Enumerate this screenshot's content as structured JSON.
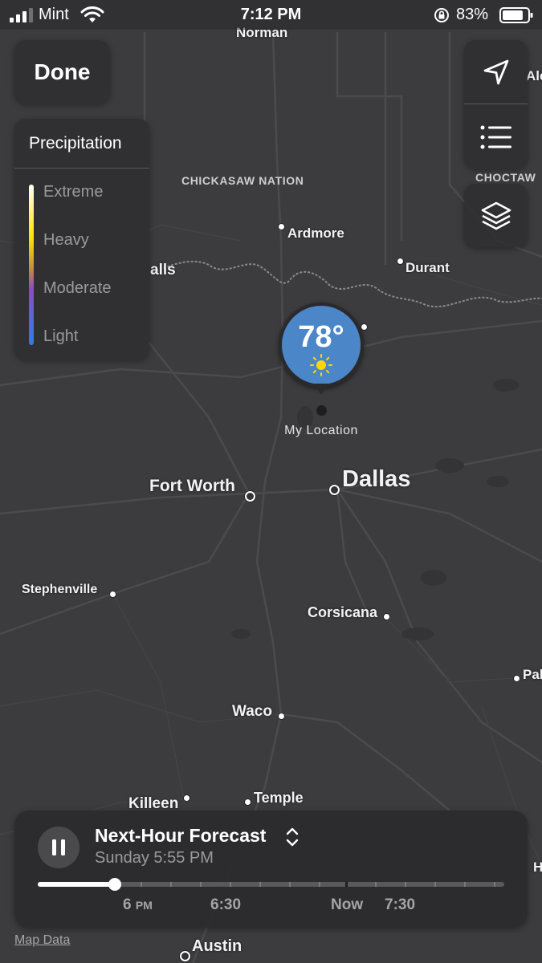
{
  "status_bar": {
    "carrier": "Mint",
    "time": "7:12 PM",
    "battery_percent": "83%",
    "battery_level": 0.83
  },
  "done_label": "Done",
  "controls": {
    "location_icon": "location-arrow-icon",
    "list_icon": "list-icon",
    "layers_icon": "layers-icon"
  },
  "legend": {
    "title": "Precipitation",
    "levels": [
      "Extreme",
      "Heavy",
      "Moderate",
      "Light"
    ]
  },
  "marker": {
    "temperature": "78°",
    "condition_icon": "sun-icon",
    "location_label": "My Location"
  },
  "map": {
    "cities": {
      "norman": "Norman",
      "ardmore": "Ardmore",
      "durant": "Durant",
      "alls": "alls",
      "ale": "Ale",
      "fort_worth": "Fort Worth",
      "dallas": "Dallas",
      "stephenville": "Stephenville",
      "corsicana": "Corsicana",
      "pal": "Pal",
      "waco": "Waco",
      "killeen": "Killeen",
      "temple": "Temple",
      "austin": "Austin",
      "h": "H"
    },
    "regions": {
      "chickasaw": "CHICKASAW NATION",
      "choctaw": "CHOCTAW"
    }
  },
  "forecast": {
    "title": "Next-Hour Forecast",
    "subtitle": "Sunday 5:55 PM",
    "progress": 0.165,
    "timeline_labels": {
      "six_hour": "6",
      "six_suffix": "PM",
      "six_thirty": "6:30",
      "now": "Now",
      "seven_thirty": "7:30"
    }
  },
  "map_data_link": "Map Data"
}
